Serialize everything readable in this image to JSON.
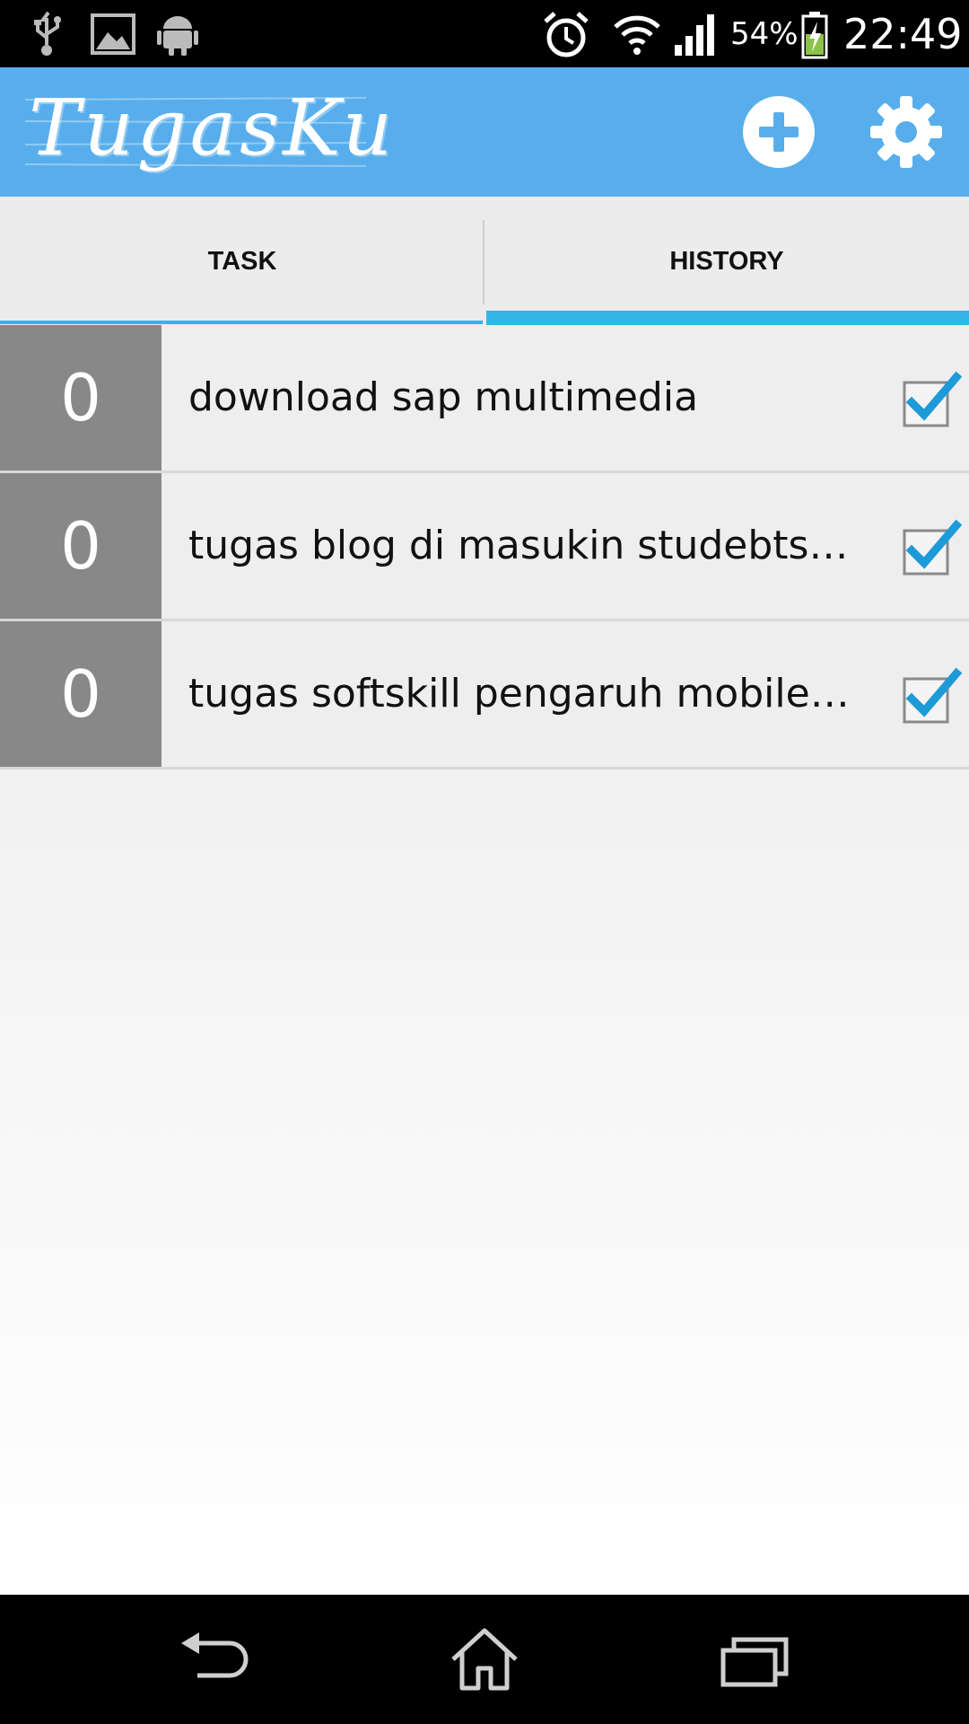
{
  "status_bar": {
    "left_icons": [
      "usb-icon",
      "image-icon",
      "android-icon"
    ],
    "right_icons": [
      "alarm-icon",
      "wifi-icon",
      "signal-icon",
      "battery-charging-icon"
    ],
    "battery": "54%",
    "time": "22:49"
  },
  "action_bar": {
    "title": "TugasKu",
    "actions": [
      "add-icon",
      "settings-icon"
    ],
    "color": "#58aeec"
  },
  "tabs": [
    {
      "label": "TASK",
      "selected": false
    },
    {
      "label": "HISTORY",
      "selected": true
    }
  ],
  "tasks": [
    {
      "count": "0",
      "title": "download sap multimedia",
      "checked": true
    },
    {
      "count": "0",
      "title": "tugas blog di masukin studebtsite",
      "checked": true
    },
    {
      "count": "0",
      "title": "tugas softskill pengaruh mobile co...",
      "checked": true
    }
  ],
  "nav_bar": [
    "back-icon",
    "home-icon",
    "recent-apps-icon"
  ],
  "colors": {
    "accent": "#33b5e5",
    "checkmark": "#1d9ad8",
    "count_bg": "#888888"
  }
}
